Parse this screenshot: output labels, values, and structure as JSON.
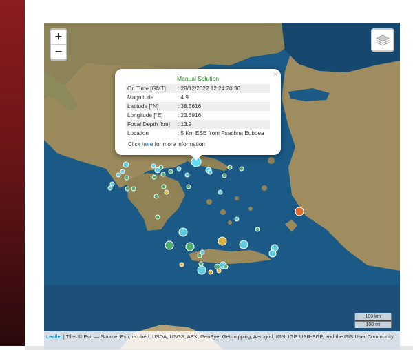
{
  "map": {
    "zoom_in": "+",
    "zoom_out": "−",
    "layers_icon": "layers-icon",
    "scale_km": "100 km",
    "scale_mi": "100 mi",
    "attribution_link": "Leaflet",
    "attribution_text": " | Tiles © Esri — Source: Esri, i-cubed, USDA, USGS, AEX, GeoEye, Getmapping, Aerogrid, IGN, IGP, UPR-EGP, and the GIS User Community",
    "colors": {
      "sea": "#1b5a86",
      "land": "#9a8a5c",
      "highlight": "#5fe0f2"
    }
  },
  "popup": {
    "title": "Manual Solution",
    "close": "×",
    "rows": [
      {
        "label": "Or. Time [GMT]",
        "value": ": 28/12/2022 12:24:20.36"
      },
      {
        "label": "Magnitude",
        "value": ": 4.9"
      },
      {
        "label": "Latitude [°N]",
        "value": ": 38.5616"
      },
      {
        "label": "Longitude [°E]",
        "value": ": 23.6916"
      },
      {
        "label": "Focal Depth [km]",
        "value": ": 13.2"
      },
      {
        "label": "Location",
        "value": ": 5 Km ESE from Psachna Euboea"
      }
    ],
    "link_prefix": "Click ",
    "link_text": "here",
    "link_suffix": " for more information"
  }
}
